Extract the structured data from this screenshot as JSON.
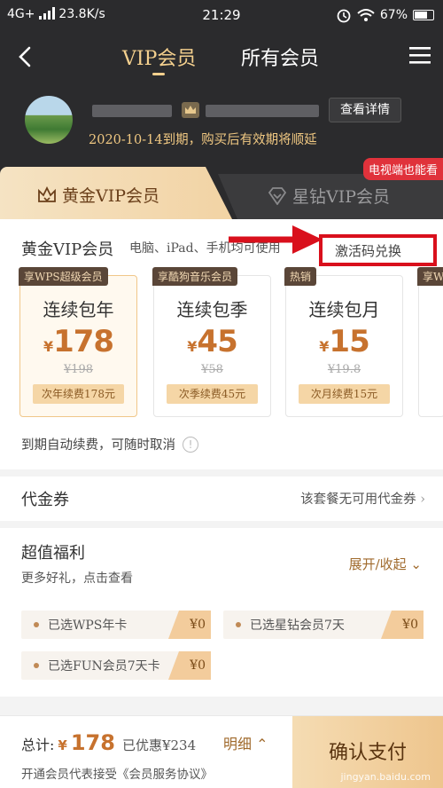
{
  "status": {
    "network": "4G+",
    "speed": "23.8K/s",
    "time": "21:29",
    "battery": "67%"
  },
  "header": {
    "tab_vip": "VIP会员",
    "tab_all": "所有会员"
  },
  "user": {
    "detail_button": "查看详情",
    "expire_text": "2020-10-14到期，购买后有效期将顺延"
  },
  "member_tabs": {
    "gold": "黄金VIP会员",
    "star": "星钻VIP会员",
    "tv_badge": "电视端也能看"
  },
  "gold_section": {
    "title": "黄金VIP会员",
    "subtitle": "电脑、iPad、手机均可使用",
    "redeem_label": "激活码兑换",
    "plans": [
      {
        "tag": "享WPS超级会员",
        "name": "连续包年",
        "currency": "¥",
        "price": "178",
        "original": "¥198",
        "renew": "次年续费178元",
        "selected": true
      },
      {
        "tag": "享酷狗音乐会员",
        "name": "连续包季",
        "currency": "¥",
        "price": "45",
        "original": "¥58",
        "renew": "次季续费45元",
        "selected": false
      },
      {
        "tag": "热销",
        "name": "连续包月",
        "currency": "¥",
        "price": "15",
        "original": "¥19.8",
        "renew": "次月续费15元",
        "selected": false
      },
      {
        "tag": "享W",
        "name": "",
        "currency": "",
        "price": "",
        "original": "",
        "renew": "",
        "selected": false
      }
    ],
    "auto_renew_note": "到期自动续费，可随时取消"
  },
  "voucher": {
    "title": "代金券",
    "value": "该套餐无可用代金券"
  },
  "benefits": {
    "title": "超值福利",
    "subtitle": "更多好礼，点击查看",
    "toggle": "展开/收起",
    "items": [
      {
        "label": "已选WPS年卡",
        "amount": "¥0"
      },
      {
        "label": "已选星钻会员7天",
        "amount": "¥0"
      },
      {
        "label": "已选FUN会员7天卡",
        "amount": "¥0"
      }
    ]
  },
  "footer": {
    "total_label": "总计:",
    "currency": "¥",
    "total": "178",
    "discount": "已优惠¥234",
    "detail_label": "明细",
    "agreement": "开通会员代表接受《会员服务协议》",
    "confirm": "确认支付",
    "watermark": "jingyan.baidu.com"
  },
  "colors": {
    "dark_bg": "#2b2b2d",
    "gold_text": "#f4d08e",
    "price": "#c7722e",
    "highlight_box": "#d9101c"
  }
}
